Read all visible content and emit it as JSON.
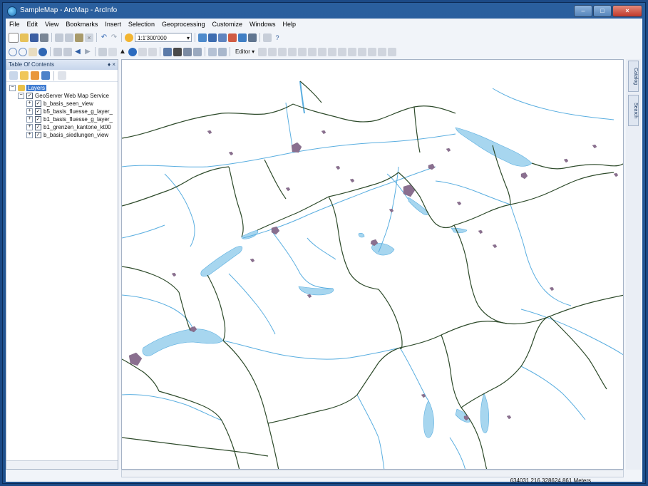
{
  "window": {
    "title": "SampleMap - ArcMap - ArcInfo"
  },
  "menu": [
    "File",
    "Edit",
    "View",
    "Bookmarks",
    "Insert",
    "Selection",
    "Geoprocessing",
    "Customize",
    "Windows",
    "Help"
  ],
  "toolbar": {
    "scale": "1:1'300'000",
    "editor_label": "Editor ▾"
  },
  "toc": {
    "title": "Table Of Contents",
    "controls": "♦ ×",
    "root_label": "Layers",
    "service_label": "GeoServer Web Map Service",
    "layers": [
      "b_basis_seen_view",
      "b5_basis_fluesse_g_layer_",
      "b1_basis_fluesse_g_layer_",
      "b1_grenzen_kantone_kt00",
      "b_basis_siedlungen_view"
    ]
  },
  "docks": {
    "catalog": "Catalog",
    "search": "Search"
  },
  "status": {
    "coordinates": "634031.216  328624.861 Meters"
  },
  "colors": {
    "water": "#a7d6ef",
    "river": "#5aaee0",
    "boundary": "#2d4a2a",
    "settlement": "#8a6f8f"
  }
}
